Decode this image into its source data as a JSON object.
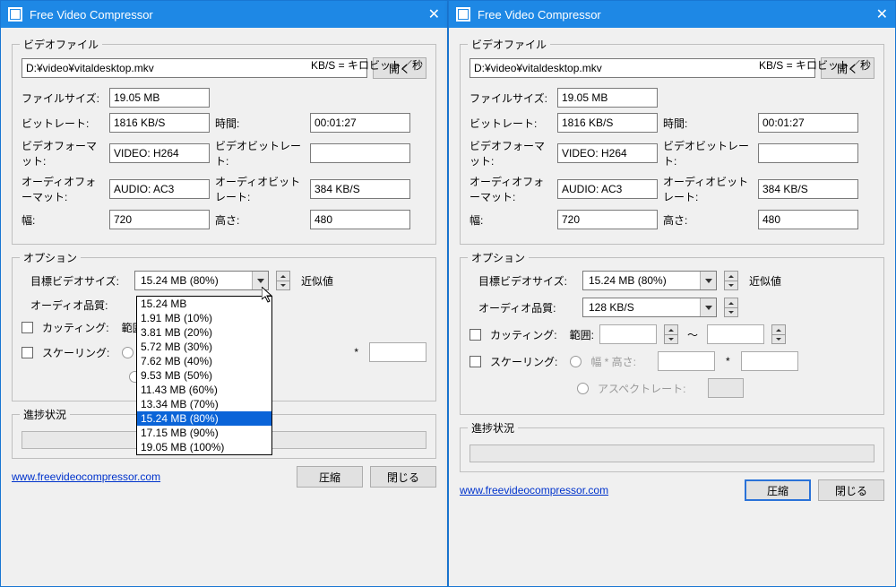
{
  "app": {
    "title": "Free Video Compressor"
  },
  "video": {
    "group_label": "ビデオファイル",
    "path": "D:¥video¥vitaldesktop.mkv",
    "open_btn": "開く",
    "kbps_note": "KB/S = キロビット／秒",
    "labels": {
      "filesize": "ファイルサイズ:",
      "bitrate": "ビットレート:",
      "duration": "時間:",
      "format": "ビデオフォーマット:",
      "vbitrate": "ビデオビットレート:",
      "aformat": "オーディオフォーマット:",
      "abitrate": "オーディオビットレート:",
      "width": "幅:",
      "height": "高さ:"
    },
    "values": {
      "filesize": "19.05 MB",
      "bitrate": "1816 KB/S",
      "duration": "00:01:27",
      "format": "VIDEO: H264",
      "vbitrate": "",
      "aformat": "AUDIO: AC3",
      "abitrate": "384 KB/S",
      "width": "720",
      "height": "480"
    }
  },
  "options": {
    "group_label": "オプション",
    "target_label": "目標ビデオサイズ:",
    "target_value": "15.24 MB (80%)",
    "approx": "近似値",
    "audio_label": "オーディオ品質:",
    "audio_value": "128 KB/S",
    "cutting_label": "カッティング:",
    "range_label": "範囲:",
    "scaling_label": "スケーリング:",
    "whs_label": "幅 * 高さ:",
    "aspect_label": "アスペクトレート:",
    "tilde": "～",
    "dropdown_items": [
      "15.24 MB",
      "1.91 MB (10%)",
      "3.81 MB (20%)",
      "5.72 MB (30%)",
      "7.62 MB (40%)",
      "9.53 MB (50%)",
      "11.43 MB (60%)",
      "13.34 MB (70%)",
      "15.24 MB (80%)",
      "17.15 MB (90%)",
      "19.05 MB (100%)"
    ],
    "dropdown_selected_index": 8
  },
  "progress": {
    "group_label": "進捗状況"
  },
  "footer": {
    "url": "www.freevideocompressor.com",
    "compress": "圧縮",
    "close": "閉じる"
  }
}
